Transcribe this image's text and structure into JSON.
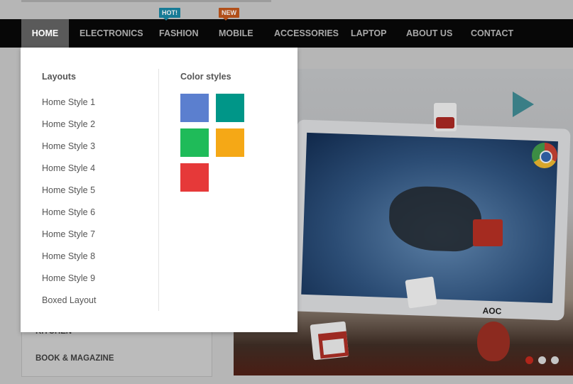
{
  "nav": {
    "items": [
      {
        "label": "HOME"
      },
      {
        "label": "ELECTRONICS"
      },
      {
        "label": "FASHION",
        "badge": "HOT!"
      },
      {
        "label": "MOBILE",
        "badge": "NEW"
      },
      {
        "label": "ACCESSORIES"
      },
      {
        "label": "LAPTOP"
      },
      {
        "label": "ABOUT US"
      },
      {
        "label": "CONTACT"
      }
    ]
  },
  "sidebar": {
    "items": [
      {
        "label": "KITCHEN"
      },
      {
        "label": "BOOK & MAGAZINE"
      }
    ]
  },
  "mega_menu": {
    "layouts": {
      "title": "Layouts",
      "links": [
        "Home Style 1",
        "Home Style 2",
        "Home Style 3",
        "Home Style 4",
        "Home Style 5",
        "Home Style 6",
        "Home Style 7",
        "Home Style 8",
        "Home Style 9",
        "Boxed Layout"
      ]
    },
    "color_styles": {
      "title": "Color styles",
      "swatches": [
        "#5b7fcf",
        "#009688",
        "#1fbb59",
        "#f5a816",
        "#e63939"
      ]
    }
  },
  "banner": {
    "brand_text": "AOC",
    "slides": 3,
    "active_slide": 1,
    "icons": [
      "youtube-icon",
      "google-play-icon",
      "chrome-icon",
      "google-plus-icon",
      "google-maps-icon",
      "gmail-icon"
    ]
  }
}
